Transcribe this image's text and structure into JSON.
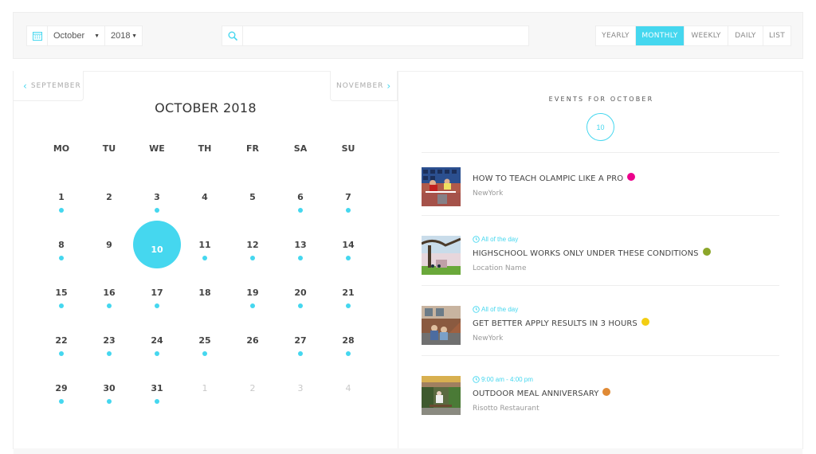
{
  "toolbar": {
    "calendar_icon": "calendar-icon",
    "month_select": "October",
    "year_select": "2018",
    "search_icon": "search-icon",
    "search_value": "",
    "search_placeholder": "",
    "views": [
      {
        "label": "YEARLY",
        "active": false
      },
      {
        "label": "MONTHLY",
        "active": true
      },
      {
        "label": "WEEKLY",
        "active": false
      },
      {
        "label": "DAILY",
        "active": false
      },
      {
        "label": "LIST",
        "active": false
      }
    ]
  },
  "calendar": {
    "prev_label": "SEPTEMBER",
    "next_label": "NOVEMBER",
    "title": "OCTOBER 2018",
    "weekdays": [
      "MO",
      "TU",
      "WE",
      "TH",
      "FR",
      "SA",
      "SU"
    ],
    "days": [
      {
        "n": "1",
        "dot": true
      },
      {
        "n": "2",
        "dot": false
      },
      {
        "n": "3",
        "dot": true
      },
      {
        "n": "4",
        "dot": false
      },
      {
        "n": "5",
        "dot": false
      },
      {
        "n": "6",
        "dot": true
      },
      {
        "n": "7",
        "dot": true
      },
      {
        "n": "8",
        "dot": true
      },
      {
        "n": "9",
        "dot": false
      },
      {
        "n": "10",
        "dot": false,
        "selected": true
      },
      {
        "n": "11",
        "dot": true
      },
      {
        "n": "12",
        "dot": true
      },
      {
        "n": "13",
        "dot": true
      },
      {
        "n": "14",
        "dot": true
      },
      {
        "n": "15",
        "dot": true
      },
      {
        "n": "16",
        "dot": true
      },
      {
        "n": "17",
        "dot": true
      },
      {
        "n": "18",
        "dot": false
      },
      {
        "n": "19",
        "dot": true
      },
      {
        "n": "20",
        "dot": true
      },
      {
        "n": "21",
        "dot": true
      },
      {
        "n": "22",
        "dot": true
      },
      {
        "n": "23",
        "dot": true
      },
      {
        "n": "24",
        "dot": true
      },
      {
        "n": "25",
        "dot": true
      },
      {
        "n": "26",
        "dot": false
      },
      {
        "n": "27",
        "dot": true
      },
      {
        "n": "28",
        "dot": true
      },
      {
        "n": "29",
        "dot": true
      },
      {
        "n": "30",
        "dot": true
      },
      {
        "n": "31",
        "dot": true
      },
      {
        "n": "1",
        "dot": false,
        "other": true
      },
      {
        "n": "2",
        "dot": false,
        "other": true
      },
      {
        "n": "3",
        "dot": false,
        "other": true
      },
      {
        "n": "4",
        "dot": false,
        "other": true
      }
    ]
  },
  "events_panel": {
    "heading": "EVENTS FOR OCTOBER",
    "count": "10",
    "events": [
      {
        "time": "",
        "title": "HOW TO TEACH OLAMPIC LIKE A PRO",
        "location": "NewYork",
        "color": "#ec008c",
        "thumb": "hurdles-race-photo"
      },
      {
        "time": "All of the day",
        "title": "HIGHSCHOOL WORKS ONLY UNDER THESE CONDITIONS",
        "location": "Location Name",
        "color": "#8ca62a",
        "thumb": "campus-tree-photo"
      },
      {
        "time": "All of the day",
        "title": "GET BETTER APPLY RESULTS IN 3 HOURS",
        "location": "NewYork",
        "color": "#f3ce13",
        "thumb": "students-stairs-photo"
      },
      {
        "time": "9:00 am - 4:00 pm",
        "title": "OUTDOOR MEAL ANNIVERSARY",
        "location": "Risotto Restaurant",
        "color": "#e08a35",
        "thumb": "outdoor-restaurant-photo"
      }
    ]
  },
  "colors": {
    "accent": "#45d7ef"
  }
}
